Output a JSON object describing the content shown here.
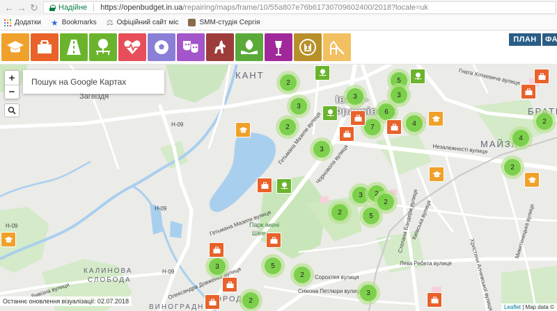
{
  "browser": {
    "secure_label": "Надійне",
    "url_main": "https://openbudget.in.ua",
    "url_rest": "/repairing/maps/frame/10/55a807e76b61730709602400/2018?locale=uk"
  },
  "bookmarks": [
    {
      "icon": "apps-icon",
      "label": "Додатки"
    },
    {
      "icon": "star-icon",
      "label": "Bookmarks"
    },
    {
      "icon": "flask-icon",
      "label": "Офіційний сайт міс"
    },
    {
      "icon": "smm-icon",
      "label": "SMM-студія Сергія"
    }
  ],
  "categories": [
    {
      "name": "education",
      "color": "#f0a12b",
      "icon": "graduation-cap-icon"
    },
    {
      "name": "repair",
      "color": "#e8622a",
      "icon": "toolbox-icon"
    },
    {
      "name": "roads",
      "color": "#6ab42d",
      "icon": "road-icon"
    },
    {
      "name": "parks",
      "color": "#6ab42d",
      "icon": "tree-bench-icon"
    },
    {
      "name": "health",
      "color": "#e84e5a",
      "icon": "heart-pulse-icon"
    },
    {
      "name": "sport",
      "color": "#8a7fd6",
      "icon": "ball-icon"
    },
    {
      "name": "culture",
      "color": "#a455c9",
      "icon": "masks-icon"
    },
    {
      "name": "history",
      "color": "#9e3c3c",
      "icon": "horseman-icon"
    },
    {
      "name": "ecology",
      "color": "#5aaa3a",
      "icon": "leaf-hands-icon"
    },
    {
      "name": "lighting",
      "color": "#a1289a",
      "icon": "lantern-icon"
    },
    {
      "name": "public",
      "color": "#b8902a",
      "icon": "emblem-icon"
    },
    {
      "name": "playground",
      "color": "#f2c060",
      "icon": "playground-icon"
    }
  ],
  "tabs": {
    "plan": "ПЛАН",
    "fact": "ФА"
  },
  "map": {
    "search_placeholder": "Пошук на Google Картах",
    "zoom_in": "+",
    "zoom_out": "−",
    "update_note": "Останнє оновлення візуалізації: 02.07.2018",
    "attribution_link": "Leaflet",
    "attribution_rest": " | Map data ©",
    "labels": {
      "kant": "КАНТ",
      "zagvizdia": "Загвіздя",
      "city1": "Івано-",
      "city2": "Франківськ",
      "bratky": "БРАТИ",
      "maizli": "МАЙЗЛІ",
      "kalynova1": "КАЛИНОВА",
      "kalynova2": "СЛОБОДА",
      "gorodok": "ГОРОДОК",
      "vynogradni": "ВИНОГРАДНІ",
      "park1": "Парк імені",
      "park2": "Шевч...",
      "h09a": "Н-09",
      "h09b": "Н-09",
      "h09c": "Н-09",
      "h09d": "Н-09",
      "hetmana1": "Гетьмана Мазепи вулиця",
      "hetmana2": "Гетьмана Мазепи вулиця",
      "chornovola": "Чорновола вулиця",
      "nezalezhnosti": "Незалежності вулиця",
      "khotkevycha": "Гната Хоткевича вулиця",
      "kyivska": "Київська вулиця",
      "banderi": "Степана Бандери вулиця",
      "leva": "Лева Ребета вулиця",
      "sorokhtei": "Сорохтея вулиця",
      "petliury": "Симона Петлюри вулиця",
      "dovzhenka": "Олександра Довженка вулиця",
      "khryplyvoho": "Христини Алчевської вулиця",
      "mykytynetska": "Микитинецька вулиця",
      "vyvizna": "Вивізна вулиця"
    }
  },
  "clusters": [
    {
      "count": "2"
    },
    {
      "count": "3"
    },
    {
      "count": "2"
    },
    {
      "count": "3"
    },
    {
      "count": "5"
    },
    {
      "count": "3"
    },
    {
      "count": "7"
    },
    {
      "count": "6"
    },
    {
      "count": "4"
    },
    {
      "count": "2"
    },
    {
      "count": "4"
    },
    {
      "count": "2"
    },
    {
      "count": "3"
    },
    {
      "count": "3"
    },
    {
      "count": "2"
    },
    {
      "count": "2"
    },
    {
      "count": "5"
    },
    {
      "count": "3"
    },
    {
      "count": "5"
    },
    {
      "count": "2"
    },
    {
      "count": "3"
    },
    {
      "count": "2"
    },
    {
      "count": "2"
    }
  ],
  "markers": [
    {
      "kind": "parks",
      "icon": "tree-bench-icon"
    },
    {
      "kind": "parks",
      "icon": "tree-bench-icon"
    },
    {
      "kind": "parks",
      "icon": "tree-bench-icon"
    },
    {
      "kind": "parks",
      "icon": "tree-bench-icon"
    },
    {
      "kind": "repair",
      "icon": "toolbox-icon"
    },
    {
      "kind": "repair",
      "icon": "toolbox-icon"
    },
    {
      "kind": "repair",
      "icon": "toolbox-icon"
    },
    {
      "kind": "repair",
      "icon": "toolbox-icon"
    },
    {
      "kind": "repair",
      "icon": "toolbox-icon"
    },
    {
      "kind": "repair",
      "icon": "toolbox-icon"
    },
    {
      "kind": "repair",
      "icon": "toolbox-icon"
    },
    {
      "kind": "repair",
      "icon": "toolbox-icon"
    },
    {
      "kind": "repair",
      "icon": "toolbox-icon"
    },
    {
      "kind": "repair",
      "icon": "toolbox-icon"
    },
    {
      "kind": "repair",
      "icon": "toolbox-icon"
    },
    {
      "kind": "education",
      "icon": "graduation-cap-icon"
    },
    {
      "kind": "education",
      "icon": "graduation-cap-icon"
    },
    {
      "kind": "education",
      "icon": "graduation-cap-icon"
    },
    {
      "kind": "education",
      "icon": "graduation-cap-icon"
    },
    {
      "kind": "education",
      "icon": "graduation-cap-icon"
    }
  ]
}
